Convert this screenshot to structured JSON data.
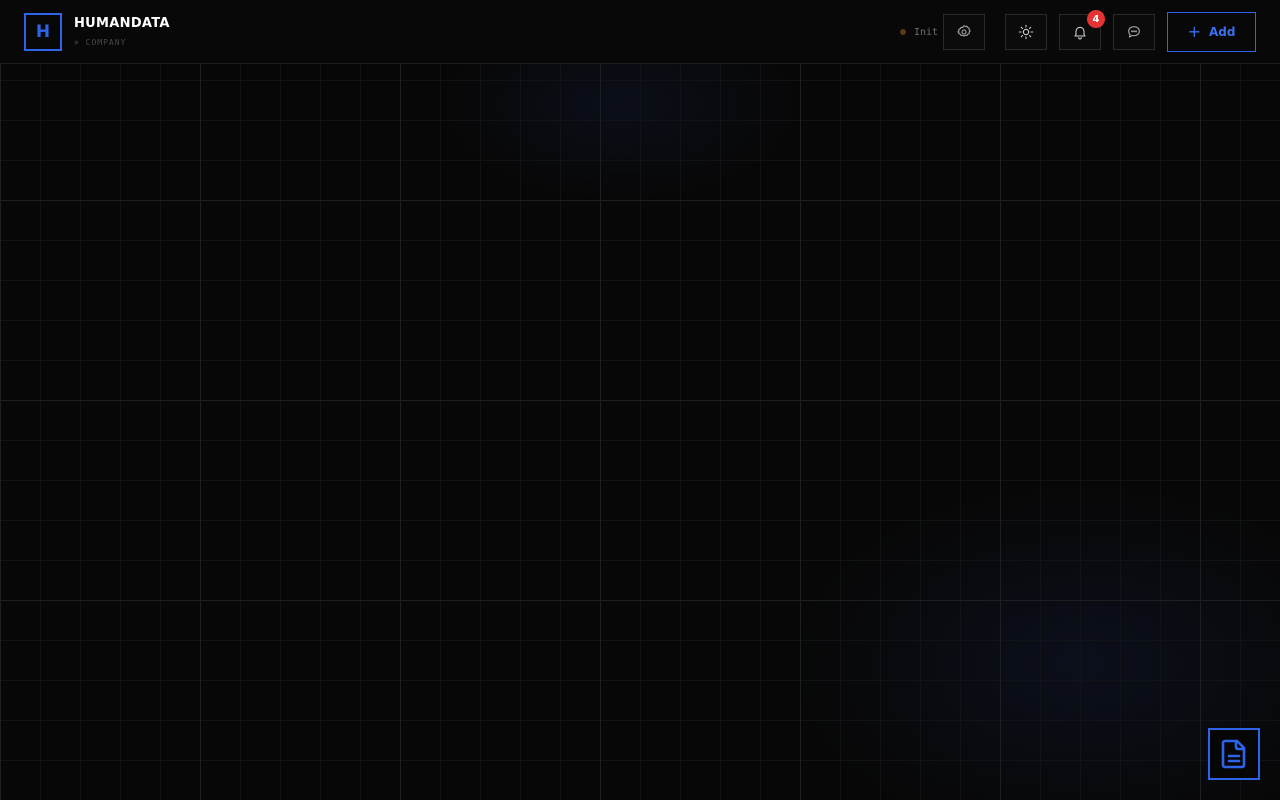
{
  "header": {
    "logo": {
      "letter": "H"
    },
    "brand": {
      "name": "HUMANDATA",
      "subtitle": "× COMPANY"
    },
    "status": {
      "text": "Init",
      "dot_color": "#5c3a12"
    },
    "buttons": {
      "settings_icon": "gear-icon",
      "theme_icon": "sun-icon",
      "notifications_icon": "bell-icon",
      "chat_icon": "chat-bubble-icon"
    },
    "notifications_badge": "4",
    "add_button": {
      "label": "Add",
      "icon": "plus-icon"
    }
  },
  "fab": {
    "icon": "document-icon"
  },
  "colors": {
    "accent": "#2f63ea",
    "badge": "#e53232",
    "background": "#070707"
  }
}
